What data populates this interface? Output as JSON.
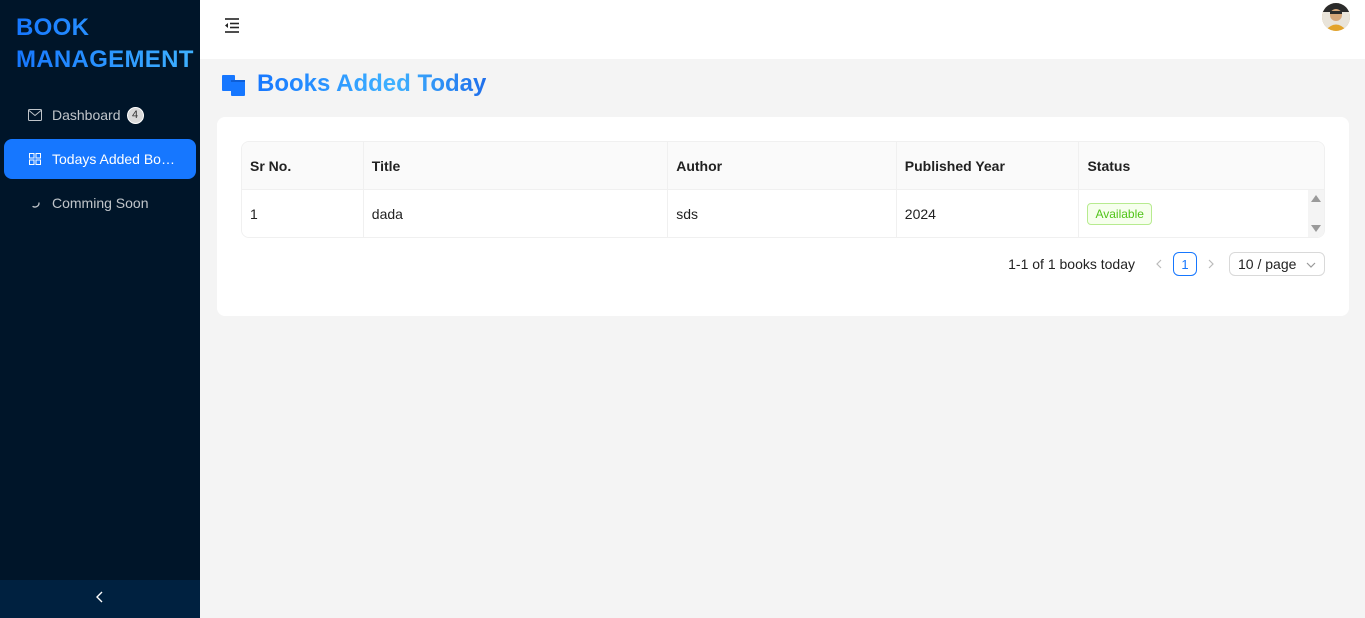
{
  "sidebar": {
    "logo": "BOOK MANAGEMENT",
    "items": [
      {
        "label": "Dashboard",
        "icon": "mail-icon",
        "badge": "4"
      },
      {
        "label": "Todays Added Books",
        "icon": "appstore-icon"
      },
      {
        "label": "Comming Soon",
        "icon": "loading-icon"
      }
    ],
    "collapse_icon": "chevron-left-icon"
  },
  "header": {
    "menu_toggle_icon": "menu-fold-icon",
    "avatar": "user-avatar"
  },
  "page": {
    "title": "Books Added Today",
    "title_icon": "books-icon"
  },
  "table": {
    "columns": [
      "Sr No.",
      "Title",
      "Author",
      "Published Year",
      "Status"
    ],
    "rows": [
      {
        "sr": "1",
        "title": "dada",
        "author": "sds",
        "year": "2024",
        "status": "Available"
      }
    ]
  },
  "pagination": {
    "total_text": "1-1 of 1 books today",
    "current_page": "1",
    "page_size": "10 / page"
  },
  "colors": {
    "sidebar_bg": "#001529",
    "accent": "#1677ff",
    "status_available": "#52c41a"
  }
}
